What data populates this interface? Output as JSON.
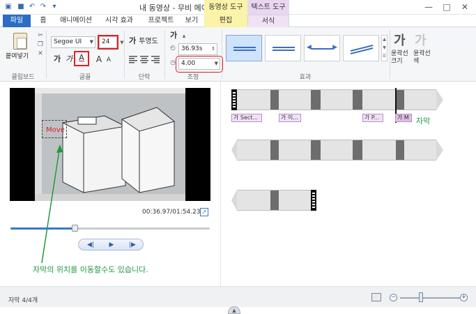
{
  "window": {
    "title": "내 동영상 - 무비 메이커",
    "context_tabs": {
      "video_tools": "동영상 도구",
      "text_tools": "텍스트 도구"
    },
    "controls": {
      "minimize": "—",
      "maximize": "□",
      "close": "✕"
    }
  },
  "tabs": [
    {
      "label": "파일"
    },
    {
      "label": "홈"
    },
    {
      "label": "애니메이션"
    },
    {
      "label": "시각 효과"
    },
    {
      "label": "프로젝트"
    },
    {
      "label": "보기"
    },
    {
      "label": "편집"
    },
    {
      "label": "서식"
    }
  ],
  "ribbon": {
    "clipboard": {
      "paste_label": "붙여넣기",
      "group_label": "클립보드"
    },
    "font": {
      "family": "Segoe UI",
      "size": "24",
      "bold_glyph": "가",
      "italic_glyph": "가",
      "color_glyph": "A",
      "grow_glyph": "A",
      "shrink_glyph": "A",
      "group_label": "글꼴"
    },
    "paragraph": {
      "transparency_label": "투명도",
      "ga_glyph": "가",
      "group_label": "단락"
    },
    "adjust": {
      "start_time": "36.93s",
      "duration": "4.00",
      "group_label": "조정"
    },
    "effects": {
      "group_label": "효과"
    },
    "outline": {
      "size_glyph": "가",
      "size_label": "윤곽선 크기",
      "color_glyph": "가",
      "color_label": "윤곽선 색"
    }
  },
  "preview": {
    "overlay_text": "Move",
    "time": "00:36.97/01:54.23",
    "seek_progress": 0.32,
    "prev_glyph": "◀|",
    "play_glyph": "▶",
    "next_glyph": "|▶",
    "fullscreen_glyph": "↗"
  },
  "annotation": "자막의 위치를 이동할수도 있습니다.",
  "storyboard": {
    "captions": [
      {
        "text": "가 Sect..."
      },
      {
        "text": "가 이..."
      },
      {
        "text": "가 P..."
      },
      {
        "text": "가 M"
      }
    ],
    "caption_label": "자막"
  },
  "status": {
    "text": "자막 4/4개",
    "zoom_level": 0.35,
    "zoom_minus": "−",
    "zoom_plus": "+"
  },
  "colors": {
    "accent": "#2b6cc4",
    "video_tools": "#fbf3a8",
    "text_tools": "#ead6f0",
    "annotation_green": "#1f9a3c",
    "highlight_red": "#e02020"
  }
}
